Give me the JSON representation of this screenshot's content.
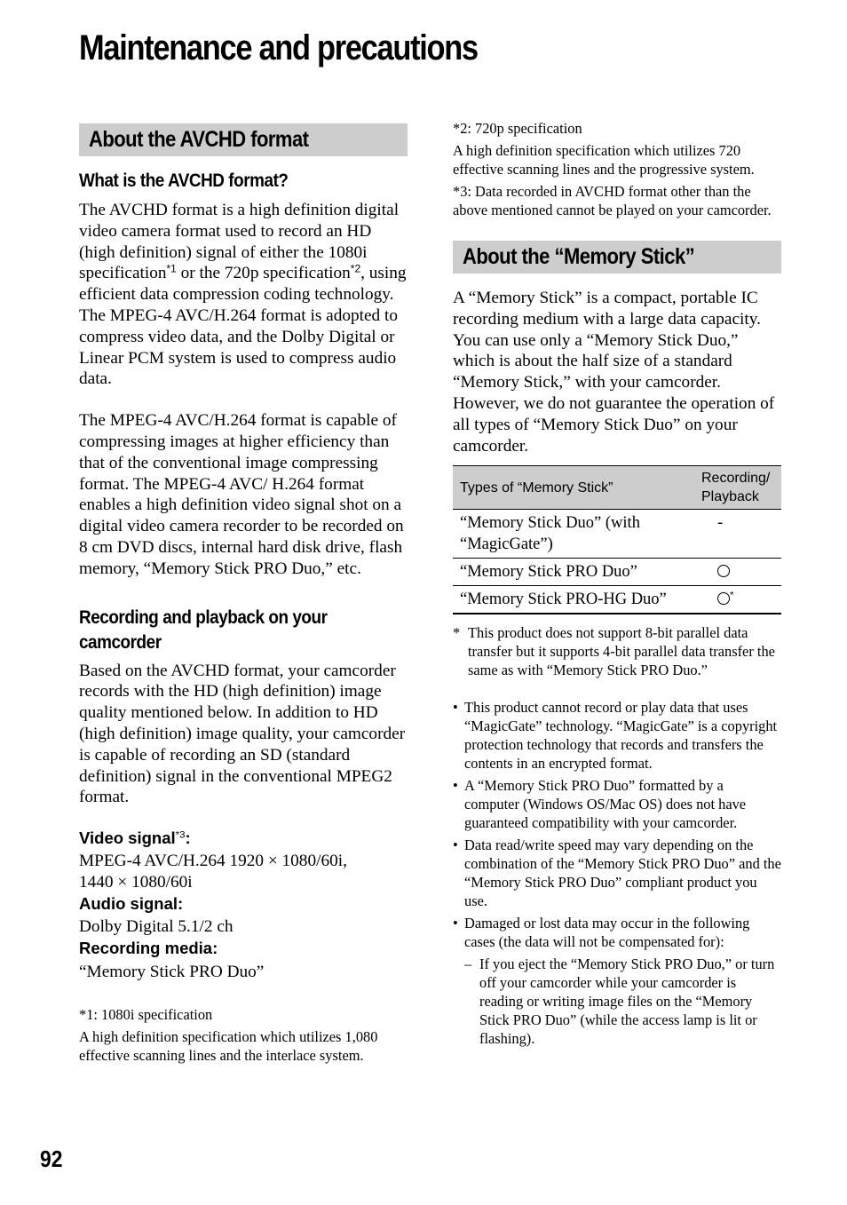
{
  "page": {
    "title": "Maintenance and precautions",
    "page_number": "92"
  },
  "left": {
    "section_title": "About the AVCHD format",
    "what_is": {
      "heading": "What is the AVCHD format?",
      "p1_a": "The AVCHD format is a high definition digital video camera format used to record an HD (high definition) signal of either the 1080i specification",
      "p1_sup1": "*1",
      "p1_b": " or the 720p specification",
      "p1_sup2": "*2",
      "p1_c": ", using efficient data compression coding technology. The MPEG-4 AVC/H.264 format is adopted to compress video data, and the Dolby Digital or Linear PCM system is used to compress audio data.",
      "p2": "The MPEG-4 AVC/H.264 format is capable of compressing images at higher efficiency than that of the conventional image compressing format. The MPEG-4 AVC/ H.264 format enables a high definition video signal shot on a digital video camera recorder to be recorded on 8 cm DVD discs, internal hard disk drive, flash memory, “Memory Stick PRO Duo,” etc."
    },
    "recording": {
      "heading": "Recording and playback on your camcorder",
      "p": "Based on the AVCHD format, your camcorder records with the HD (high definition) image quality mentioned below. In addition to HD (high definition) image quality, your camcorder is capable of recording an SD (standard definition) signal in the conventional MPEG2 format."
    },
    "specs": {
      "video_label": "Video signal",
      "video_sup": "*3",
      "video_colon": ":",
      "video_value_1": "MPEG-4 AVC/H.264 1920 × 1080/60i,",
      "video_value_2": "1440 × 1080/60i",
      "audio_label": "Audio signal:",
      "audio_value": "Dolby Digital 5.1/2 ch",
      "media_label": "Recording media:",
      "media_value": "“Memory Stick PRO Duo”"
    },
    "footnote1": {
      "title": "*1: 1080i specification",
      "text": "A high definition specification which utilizes 1,080 effective scanning lines and the interlace system."
    }
  },
  "right": {
    "footnote2": {
      "title": "*2: 720p specification",
      "text": "A high definition specification which utilizes 720 effective scanning lines and the progressive system."
    },
    "footnote3": "*3: Data recorded in AVCHD format other than the above mentioned cannot be played on your camcorder.",
    "section_title": "About the “Memory Stick”",
    "intro_1": "A “Memory Stick” is a compact, portable IC recording medium with a large data capacity.",
    "intro_2": "You can use only a “Memory Stick Duo,” which is about the half size of a standard “Memory Stick,” with your camcorder. However, we do not guarantee the operation of all types of “Memory Stick Duo” on your camcorder.",
    "table": {
      "headers": [
        "Types of “Memory Stick”",
        "Recording/ Playback"
      ],
      "rows": [
        {
          "type": "“Memory Stick Duo” (with “MagicGate”)",
          "support": "-",
          "mark": "dash"
        },
        {
          "type": "“Memory Stick PRO Duo”",
          "support": "",
          "mark": "circle"
        },
        {
          "type": "“Memory Stick PRO-HG Duo”",
          "support": "*",
          "mark": "circle-star"
        }
      ]
    },
    "star_note": {
      "mark": "*",
      "text": "This product does not support 8-bit parallel data transfer but it supports 4-bit parallel data transfer the same as with “Memory Stick PRO Duo.”"
    },
    "bullets": [
      "This product cannot record or play data that uses “MagicGate” technology. “MagicGate” is a copyright protection technology that records and transfers the contents in an encrypted format.",
      "A “Memory Stick PRO Duo” formatted by a computer (Windows OS/Mac OS) does not have guaranteed compatibility with your camcorder.",
      "Data read/write speed may vary depending on the combination of the “Memory Stick PRO Duo” and the “Memory Stick PRO Duo” compliant product you use.",
      "Damaged or lost data may occur in the following cases (the data will not be compensated for):"
    ],
    "bullet_mark": "•",
    "sub_bullets": [
      "If you eject the “Memory Stick PRO Duo,” or turn off your camcorder while your camcorder is reading or writing image files on the “Memory Stick PRO Duo” (while the access lamp is lit or flashing)."
    ],
    "dash_mark": "–"
  }
}
